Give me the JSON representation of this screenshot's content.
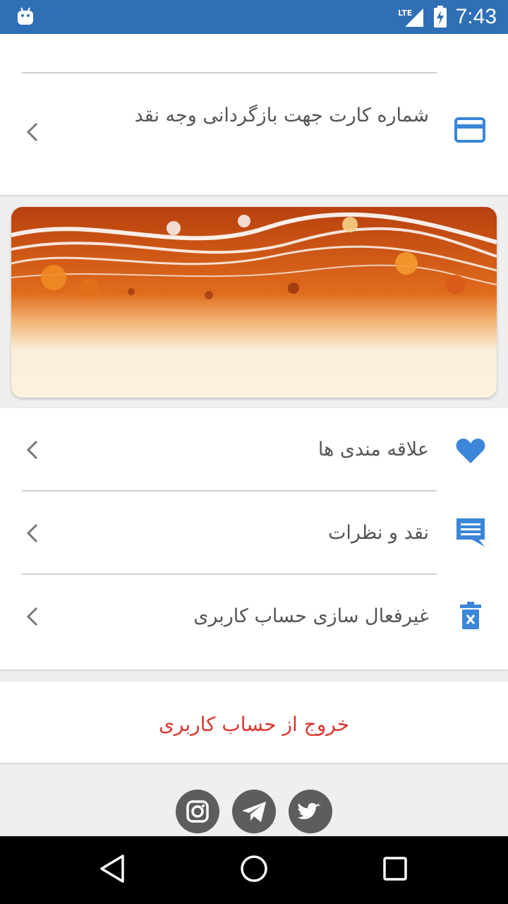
{
  "status_bar": {
    "time": "7:43",
    "network": "LTE",
    "icons": [
      "android-icon",
      "lte-signal-icon",
      "battery-charging-icon"
    ],
    "color": "#2f6fb6"
  },
  "card_section": {
    "label": "شماره کارت جهت بازگردانی وجه نقد",
    "icon": "credit-card-icon"
  },
  "menu": {
    "items": [
      {
        "label": "علاقه مندی ها",
        "icon": "heart-icon"
      },
      {
        "label": "نقد و نظرات",
        "icon": "comment-icon"
      },
      {
        "label": "غیرفعال سازی حساب کاربری",
        "icon": "delete-icon"
      }
    ]
  },
  "logout": {
    "label": "خروج از حساب کاربری",
    "color": "#d9382f"
  },
  "social": [
    "instagram-icon",
    "telegram-icon",
    "twitter-icon"
  ],
  "colors": {
    "accent": "#3b86d8",
    "text": "#555555",
    "divider": "#cfcfcf"
  }
}
